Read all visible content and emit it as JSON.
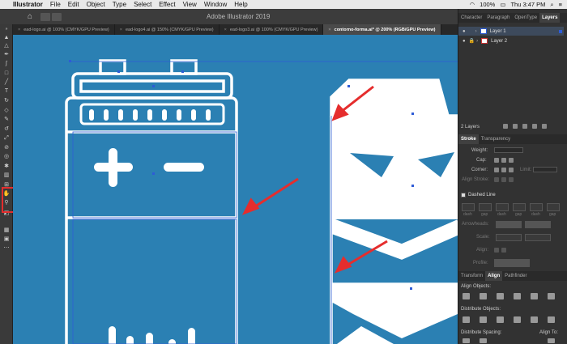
{
  "menubar": {
    "app_name": "Illustrator",
    "items": [
      "File",
      "Edit",
      "Object",
      "Type",
      "Select",
      "Effect",
      "View",
      "Window",
      "Help"
    ],
    "battery": "100%",
    "clock": "Thu 3:47 PM"
  },
  "appbar": {
    "title": "Adobe Illustrator 2019"
  },
  "tabs": [
    {
      "label": "ead-logo.ai @ 100% (CMYK/GPU Preview)"
    },
    {
      "label": "ead-logo4.ai @ 150% (CMYK/GPU Preview)"
    },
    {
      "label": "ead-logo3.ai @ 100% (CMYK/GPU Preview)"
    },
    {
      "label": "contorno-forma.ai* @ 200% (RGB/GPU Preview)",
      "active": true
    }
  ],
  "panel_tabs": [
    "Character",
    "Paragraph",
    "OpenType",
    "Layers"
  ],
  "layers": [
    {
      "name": "Layer 1"
    },
    {
      "name": "Layer 2"
    }
  ],
  "layers_count": "2 Layers",
  "stroke_panel": {
    "tabs": [
      "Stroke",
      "Transparency"
    ],
    "weight_label": "Weight:",
    "cap_label": "Cap:",
    "corner_label": "Corner:",
    "limit_label": "Limit:",
    "align_stroke_label": "Align Stroke:",
    "dashed_line_label": "Dashed Line",
    "dash_labels": [
      "dash",
      "gap",
      "dash",
      "gap",
      "dash",
      "gap"
    ],
    "arrowheads_label": "Arrowheads:",
    "scale_label": "Scale:",
    "align_label": "Align:",
    "profile_label": "Profile:"
  },
  "align_panel": {
    "tabs": [
      "Transform",
      "Align",
      "Pathfinder"
    ],
    "align_objects_label": "Align Objects:",
    "distribute_objects_label": "Distribute Objects:",
    "distribute_spacing_label": "Distribute Spacing:",
    "align_to_label": "Align To:"
  },
  "colors": {
    "canvas": "#2b80b3",
    "shape_stroke": "#ffffff",
    "arrow": "#e52d2d",
    "highlight_box": "#e52d2d",
    "selection": "#2e5cd6"
  }
}
